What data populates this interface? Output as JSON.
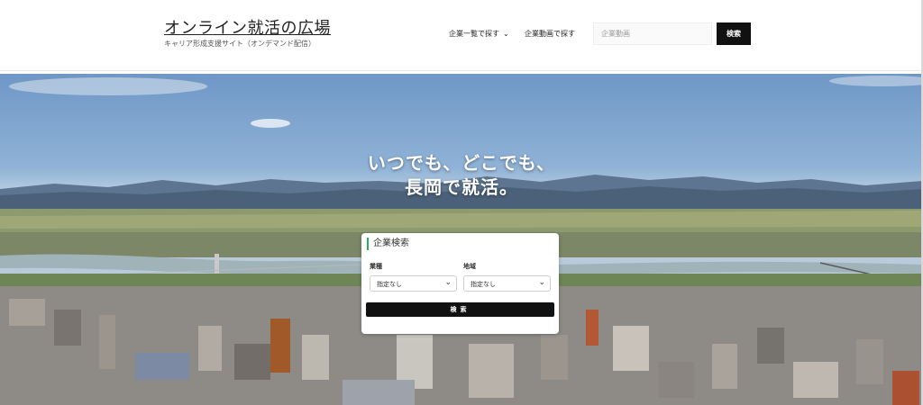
{
  "header": {
    "title": "オンライン就活の広場",
    "subtitle": "キャリア形成支援サイト（オンデマンド配信）",
    "nav": {
      "companies_label": "企業一覧で探す",
      "videos_label": "企業動画で探す"
    },
    "search": {
      "placeholder": "企業動画",
      "button_label": "検索"
    }
  },
  "hero": {
    "heading_line1": "いつでも、どこでも、",
    "heading_line2": "長岡で就活。"
  },
  "search_card": {
    "title": "企業検索",
    "industry_label": "業種",
    "industry_value": "指定なし",
    "region_label": "地域",
    "region_value": "指定なし",
    "submit_label": "検索"
  },
  "colors": {
    "accent_green": "#27ae60",
    "button_black": "#111111",
    "sky": "#8fb2d6"
  }
}
